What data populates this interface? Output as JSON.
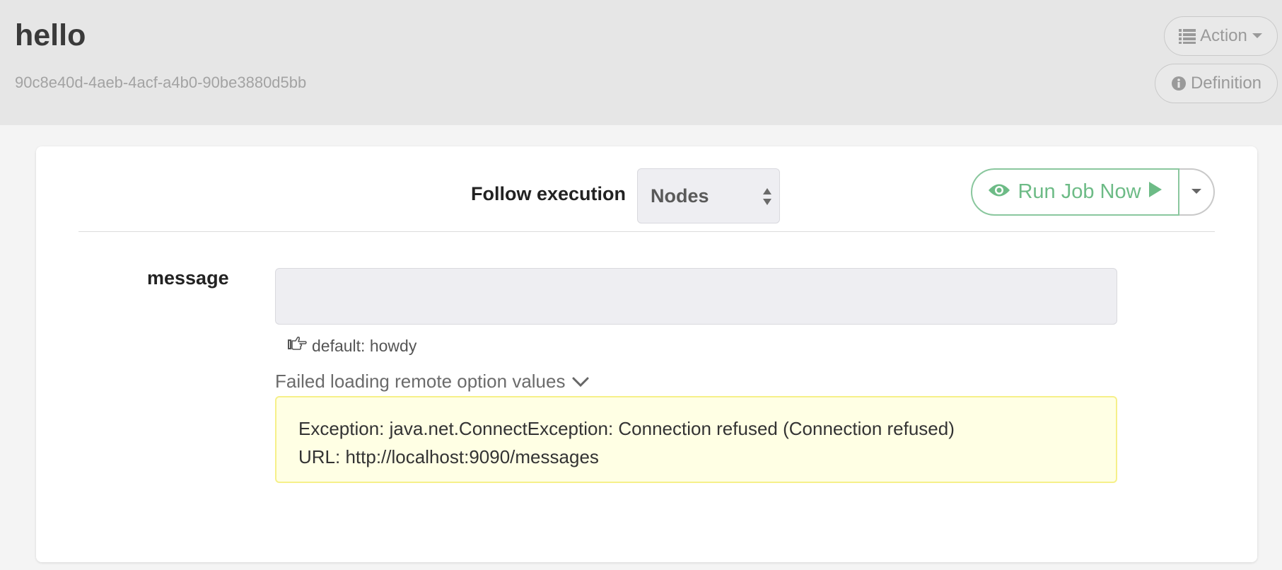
{
  "job": {
    "title": "hello",
    "uuid": "90c8e40d-4aeb-4acf-a4b0-90be3880d5bb"
  },
  "header_actions": {
    "action_label": "Action",
    "definition_label": "Definition"
  },
  "run_form": {
    "follow_label": "Follow execution",
    "follow_select_value": "Nodes",
    "run_button_label": "Run Job Now"
  },
  "options": [
    {
      "name": "message",
      "value": "",
      "default_hint": "default: howdy",
      "remote_status": "Failed loading remote option values",
      "error_lines": [
        "Exception: java.net.ConnectException: Connection refused (Connection refused)",
        "URL: http://localhost:9090/messages"
      ]
    }
  ],
  "colors": {
    "header_bg": "#e6e6e6",
    "run_green": "#6dbb86",
    "error_bg": "#ffffe4",
    "error_border": "#f6f08a"
  },
  "icons": {
    "action": "list-icon",
    "definition": "info-circle-icon",
    "run": "eye-icon",
    "run_play": "play-icon",
    "hint": "hand-point-right-icon",
    "toggle": "chevron-down-icon"
  }
}
